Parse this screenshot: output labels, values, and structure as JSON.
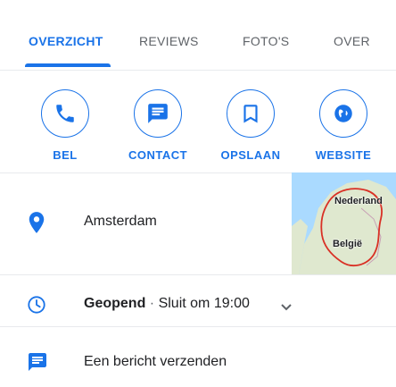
{
  "tabs": [
    {
      "label": "OVERZICHT",
      "active": true
    },
    {
      "label": "REVIEWS",
      "active": false
    },
    {
      "label": "FOTO'S",
      "active": false
    },
    {
      "label": "OVER",
      "active": false
    }
  ],
  "actions": [
    {
      "label": "BEL",
      "icon": "phone-icon"
    },
    {
      "label": "CONTACT",
      "icon": "chat-icon"
    },
    {
      "label": "OPSLAAN",
      "icon": "bookmark-icon"
    },
    {
      "label": "WEBSITE",
      "icon": "globe-icon"
    }
  ],
  "location": {
    "address": "Amsterdam",
    "icon": "location-pin-icon",
    "map_labels": {
      "country1": "Nederland",
      "country2": "België"
    }
  },
  "hours": {
    "status": "Geopend",
    "separator": "·",
    "closing": "Sluit om 19:00",
    "icon": "clock-icon",
    "expand_icon": "chevron-down-icon"
  },
  "message": {
    "text": "Een bericht verzenden",
    "icon": "message-icon"
  },
  "colors": {
    "accent": "#1a73e8",
    "text": "#202124",
    "muted": "#5f6368",
    "divider": "#e8eaed"
  }
}
